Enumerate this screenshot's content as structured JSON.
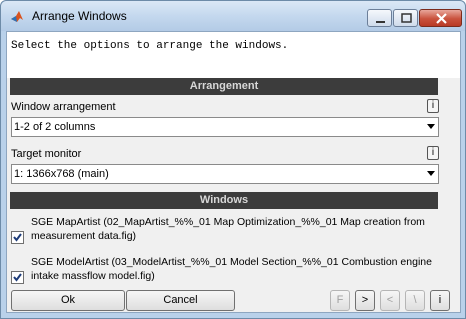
{
  "window": {
    "title": "Arrange Windows"
  },
  "instructions": "Select the options to arrange the windows.",
  "arrangement": {
    "header": "Arrangement",
    "window_arrangement_label": "Window arrangement",
    "window_arrangement_value": "1-2 of 2 columns",
    "target_monitor_label": "Target monitor",
    "target_monitor_value": "1: 1366x768 (main)",
    "info_label": "i"
  },
  "windows": {
    "header": "Windows",
    "items": [
      {
        "label": "SGE MapArtist (02_MapArtist_%%_01 Map Optimization_%%_01 Map creation from measurement data.fig)",
        "checked": true
      },
      {
        "label": "SGE ModelArtist (03_ModelArtist_%%_01 Model Section_%%_01 Combustion engine intake massflow model.fig)",
        "checked": true
      }
    ]
  },
  "footer": {
    "ok_label": "Ok",
    "cancel_label": "Cancel",
    "f_label": "F",
    "next_label": ">",
    "prev_label": "<",
    "skip_label": "\\",
    "info_label": "i"
  },
  "colors": {
    "header_bg": "#3c3c3c",
    "title_bar": "#c4d8ee",
    "close_button": "#c9523d"
  }
}
